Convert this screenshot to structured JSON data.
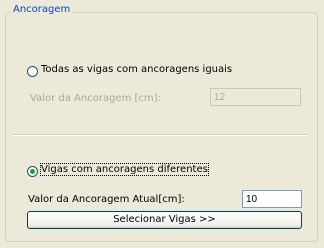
{
  "group": {
    "title": "Ancoragem"
  },
  "option_equal": {
    "label": "Todas as vigas com ancoragens iguais",
    "selected": false
  },
  "anchor_value": {
    "label": "Valor da Ancoragem [cm]:",
    "value": "12"
  },
  "option_different": {
    "label": "Vigas com ancoragens diferentes",
    "selected": true
  },
  "current_anchor": {
    "label": "Valor da Ancoragem Atual[cm]:",
    "value": "10"
  },
  "select_button": {
    "label": "Selecionar Vigas >>"
  }
}
